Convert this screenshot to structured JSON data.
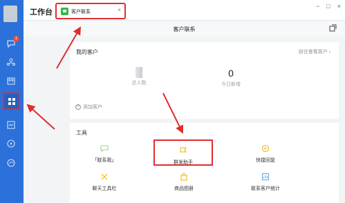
{
  "topbar": {
    "title": "工作台"
  },
  "tab": {
    "label": "客户联系",
    "close": "×"
  },
  "window_controls": [
    "−",
    "□",
    "×"
  ],
  "page": {
    "title": "客户联系"
  },
  "sidebar": {
    "badge": "1",
    "icons": [
      "message-icon",
      "contacts-icon",
      "calendar-icon",
      "workbench-icon",
      "docs-icon",
      "video-icon",
      "cloud-icon"
    ]
  },
  "customers": {
    "title": "我的客户",
    "link": "前往查看客户 ›",
    "total_label": "总人数",
    "new_count": "0",
    "new_label": "今日新增",
    "add_label": "添加客户"
  },
  "tools": {
    "title": "工具",
    "items": [
      {
        "label": "「联系我」"
      },
      {
        "label": "群发助手"
      },
      {
        "label": "快捷回复"
      },
      {
        "label": "聊天工具栏"
      },
      {
        "label": "商品图册"
      },
      {
        "label": "联系客户统计"
      }
    ]
  },
  "colors": {
    "sidebar": "#2b71d9",
    "accent_green": "#39b54a",
    "annotation_red": "#e02d2d",
    "tool_icon_yellow": "#f2b705"
  }
}
